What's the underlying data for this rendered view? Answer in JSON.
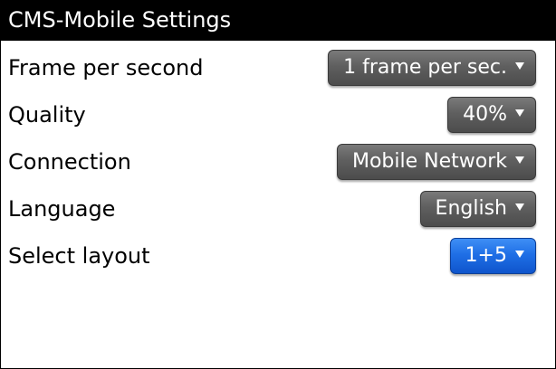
{
  "title": "CMS-Mobile Settings",
  "settings": [
    {
      "label": "Frame per second",
      "value": "1 frame per sec."
    },
    {
      "label": "Quality",
      "value": "40%"
    },
    {
      "label": "Connection",
      "value": "Mobile Network"
    },
    {
      "label": "Language",
      "value": "English"
    },
    {
      "label": "Select layout",
      "value": "1+5"
    }
  ],
  "colors": {
    "titlebar_bg": "#000000",
    "dropdown_bg": "#5f5f5f",
    "dropdown_focused_bg": "#1f6fe6"
  },
  "focused_setting": "Select layout"
}
